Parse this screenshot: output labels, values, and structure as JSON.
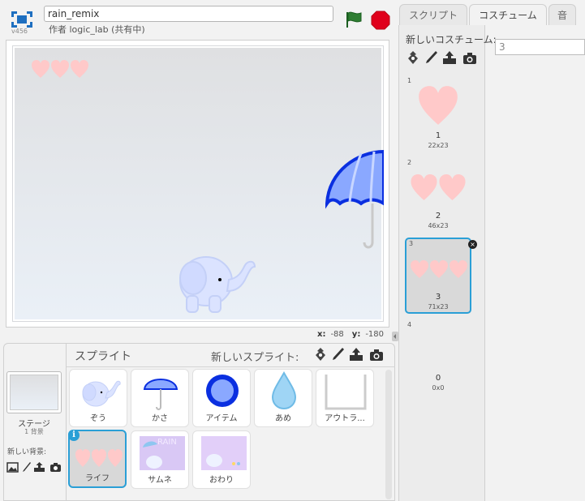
{
  "header": {
    "version": "v456",
    "project_title": "rain_remix",
    "author": "作者 logic_lab (共有中)"
  },
  "stage": {
    "x_label": "x:",
    "x_value": "-88",
    "y_label": "y:",
    "y_value": "-180"
  },
  "sprites_pane": {
    "title": "スプライト",
    "new_sprite_label": "新しいスプライト:",
    "stage_label": "ステージ",
    "backdrop_count": "1 背景",
    "new_backdrop_label": "新しい背景:",
    "sprites": [
      {
        "label": "ぞう",
        "icon": "elephant"
      },
      {
        "label": "かさ",
        "icon": "umbrella"
      },
      {
        "label": "アイテム",
        "icon": "blue-ring"
      },
      {
        "label": "あめ",
        "icon": "raindrop"
      },
      {
        "label": "アウトラ...",
        "icon": "outline-frame"
      },
      {
        "label": "ライフ",
        "icon": "three-hearts",
        "selected": true
      },
      {
        "label": "サムネ",
        "icon": "thumbnail"
      },
      {
        "label": "おわり",
        "icon": "ending"
      }
    ],
    "thumbnail_text": "RAIN"
  },
  "tabs": [
    {
      "label": "スクリプト",
      "active": false
    },
    {
      "label": "コスチューム",
      "active": true
    },
    {
      "label": "音",
      "active": false
    }
  ],
  "costumes": {
    "new_costume_label": "新しいコスチューム:",
    "current_name": "3",
    "items": [
      {
        "index": "1",
        "name": "1",
        "size": "22x23"
      },
      {
        "index": "2",
        "name": "2",
        "size": "46x23"
      },
      {
        "index": "3",
        "name": "3",
        "size": "71x23",
        "selected": true
      },
      {
        "index": "4",
        "name": "0",
        "size": "0x0"
      }
    ],
    "delete_glyph": "×"
  },
  "colors": {
    "selection": "#2a9fd6",
    "heart": "#ffc9c9",
    "umbrella": "#8aa8ff",
    "umbrella_outline": "#0a2fe0",
    "flag": "#2e7d32",
    "stop": "#e0001b"
  }
}
